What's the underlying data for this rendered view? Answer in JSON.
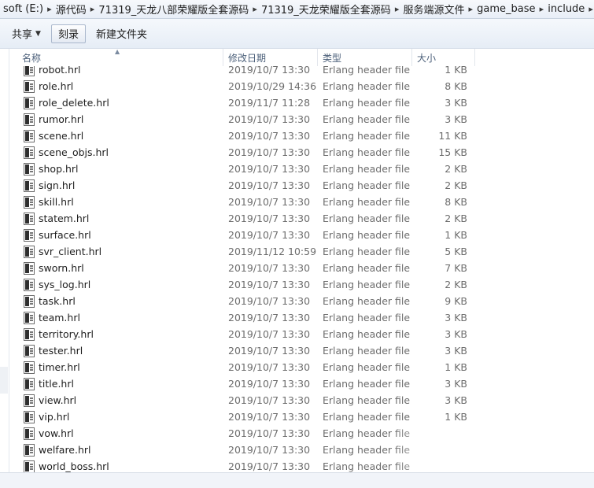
{
  "breadcrumb": [
    {
      "label": "soft (E:)"
    },
    {
      "label": "源代码"
    },
    {
      "label": "71319_天龙八部荣耀版全套源码"
    },
    {
      "label": "71319_天龙荣耀版全套源码"
    },
    {
      "label": "服务端源文件"
    },
    {
      "label": "game_base"
    },
    {
      "label": "include"
    }
  ],
  "breadcrumb_separator": "▸",
  "toolbar": {
    "share_label": "共享",
    "burn_label": "刻录",
    "new_folder_label": "新建文件夹"
  },
  "columns": {
    "name": "名称",
    "date": "修改日期",
    "type": "类型",
    "size": "大小"
  },
  "files": [
    {
      "name": "robot.hrl",
      "date": "2019/10/7 13:30",
      "type": "Erlang header file",
      "size": "1 KB"
    },
    {
      "name": "role.hrl",
      "date": "2019/10/29 14:36",
      "type": "Erlang header file",
      "size": "8 KB"
    },
    {
      "name": "role_delete.hrl",
      "date": "2019/11/7 11:28",
      "type": "Erlang header file",
      "size": "3 KB"
    },
    {
      "name": "rumor.hrl",
      "date": "2019/10/7 13:30",
      "type": "Erlang header file",
      "size": "3 KB"
    },
    {
      "name": "scene.hrl",
      "date": "2019/10/7 13:30",
      "type": "Erlang header file",
      "size": "11 KB"
    },
    {
      "name": "scene_objs.hrl",
      "date": "2019/10/7 13:30",
      "type": "Erlang header file",
      "size": "15 KB"
    },
    {
      "name": "shop.hrl",
      "date": "2019/10/7 13:30",
      "type": "Erlang header file",
      "size": "2 KB"
    },
    {
      "name": "sign.hrl",
      "date": "2019/10/7 13:30",
      "type": "Erlang header file",
      "size": "2 KB"
    },
    {
      "name": "skill.hrl",
      "date": "2019/10/7 13:30",
      "type": "Erlang header file",
      "size": "8 KB"
    },
    {
      "name": "statem.hrl",
      "date": "2019/10/7 13:30",
      "type": "Erlang header file",
      "size": "2 KB"
    },
    {
      "name": "surface.hrl",
      "date": "2019/10/7 13:30",
      "type": "Erlang header file",
      "size": "1 KB"
    },
    {
      "name": "svr_client.hrl",
      "date": "2019/11/12 10:59",
      "type": "Erlang header file",
      "size": "5 KB"
    },
    {
      "name": "sworn.hrl",
      "date": "2019/10/7 13:30",
      "type": "Erlang header file",
      "size": "7 KB"
    },
    {
      "name": "sys_log.hrl",
      "date": "2019/10/7 13:30",
      "type": "Erlang header file",
      "size": "2 KB"
    },
    {
      "name": "task.hrl",
      "date": "2019/10/7 13:30",
      "type": "Erlang header file",
      "size": "9 KB"
    },
    {
      "name": "team.hrl",
      "date": "2019/10/7 13:30",
      "type": "Erlang header file",
      "size": "3 KB"
    },
    {
      "name": "territory.hrl",
      "date": "2019/10/7 13:30",
      "type": "Erlang header file",
      "size": "3 KB"
    },
    {
      "name": "tester.hrl",
      "date": "2019/10/7 13:30",
      "type": "Erlang header file",
      "size": "3 KB"
    },
    {
      "name": "timer.hrl",
      "date": "2019/10/7 13:30",
      "type": "Erlang header file",
      "size": "1 KB"
    },
    {
      "name": "title.hrl",
      "date": "2019/10/7 13:30",
      "type": "Erlang header file",
      "size": "3 KB"
    },
    {
      "name": "view.hrl",
      "date": "2019/10/7 13:30",
      "type": "Erlang header file",
      "size": "3 KB"
    },
    {
      "name": "vip.hrl",
      "date": "2019/10/7 13:30",
      "type": "Erlang header file",
      "size": "1 KB"
    },
    {
      "name": "vow.hrl",
      "date": "2019/10/7 13:30",
      "type": "Erlang header file",
      "size": ""
    },
    {
      "name": "welfare.hrl",
      "date": "2019/10/7 13:30",
      "type": "Erlang header file",
      "size": ""
    },
    {
      "name": "world_boss.hrl",
      "date": "2019/10/7 13:30",
      "type": "Erlang header file",
      "size": ""
    }
  ]
}
